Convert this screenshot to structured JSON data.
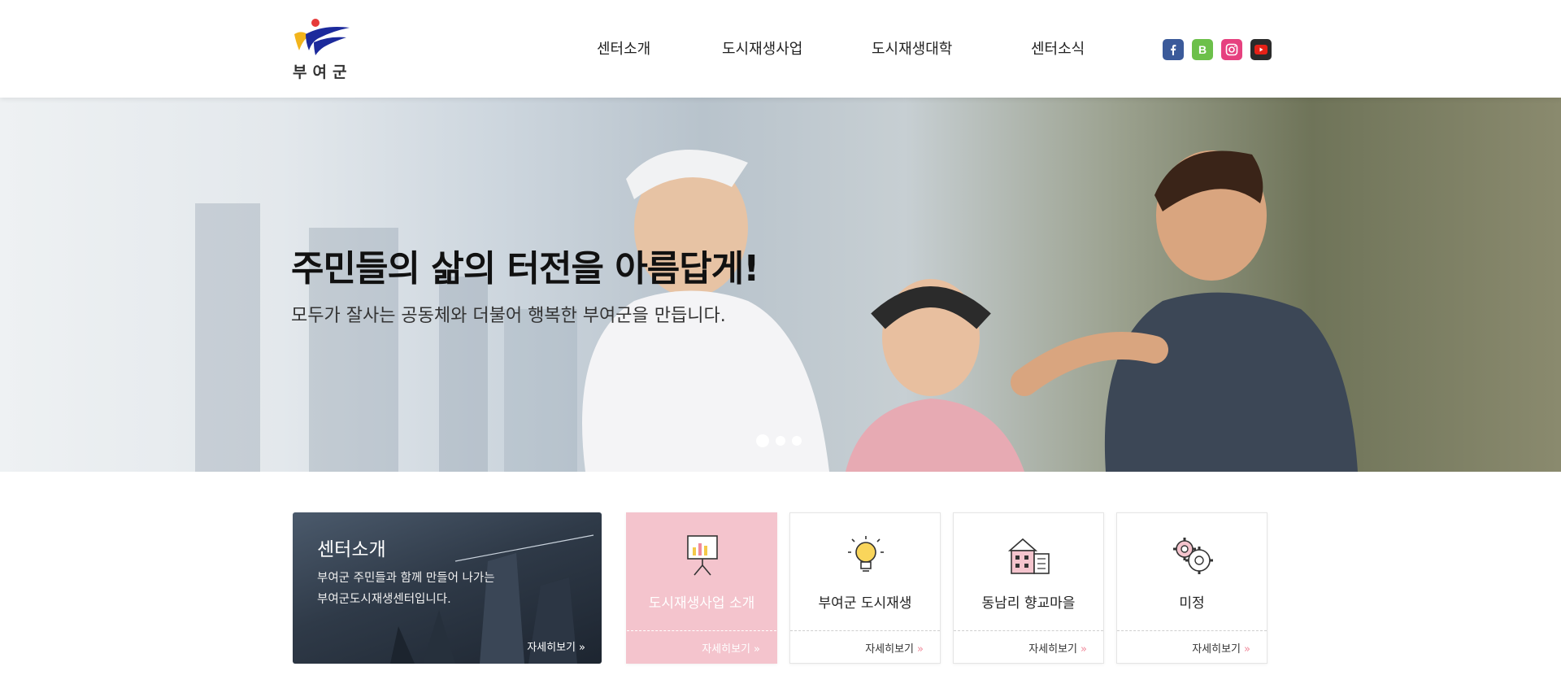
{
  "header": {
    "logo_text": "부여군",
    "nav": [
      "센터소개",
      "도시재생사업",
      "도시재생대학",
      "센터소식"
    ],
    "social": [
      {
        "name": "facebook",
        "glyph": "f",
        "color": "#3b5a9a"
      },
      {
        "name": "blog",
        "glyph": "B",
        "color": "#6cc04a"
      },
      {
        "name": "instagram",
        "glyph": "◎",
        "color": "#e6417f"
      },
      {
        "name": "youtube",
        "glyph": "▶",
        "color": "#2b2b2b"
      }
    ]
  },
  "hero": {
    "title": "주민들의 삶의 터전을 아름답게!",
    "subtitle": "모두가 잘사는 공동체와 더불어 행복한 부여군을 만듭니다.",
    "slides": 3,
    "active_slide": 1
  },
  "intro": {
    "title": "센터소개",
    "desc_line1": "부여군 주민들과 함께 만들어 나가는",
    "desc_line2": "부여군도시재생센터입니다.",
    "more": "자세히보기"
  },
  "cards": [
    {
      "label": "도시재생사업 소개",
      "more": "자세히보기",
      "icon": "presentation-board-icon",
      "active": true
    },
    {
      "label": "부여군 도시재생",
      "more": "자세히보기",
      "icon": "lightbulb-icon",
      "active": false
    },
    {
      "label": "동남리 향교마을",
      "more": "자세히보기",
      "icon": "buildings-icon",
      "active": false
    },
    {
      "label": "미정",
      "more": "자세히보기",
      "icon": "gears-icon",
      "active": false
    }
  ],
  "colors": {
    "accent_pink": "#f4c4cd",
    "chevron_pink": "#f08a9b"
  }
}
